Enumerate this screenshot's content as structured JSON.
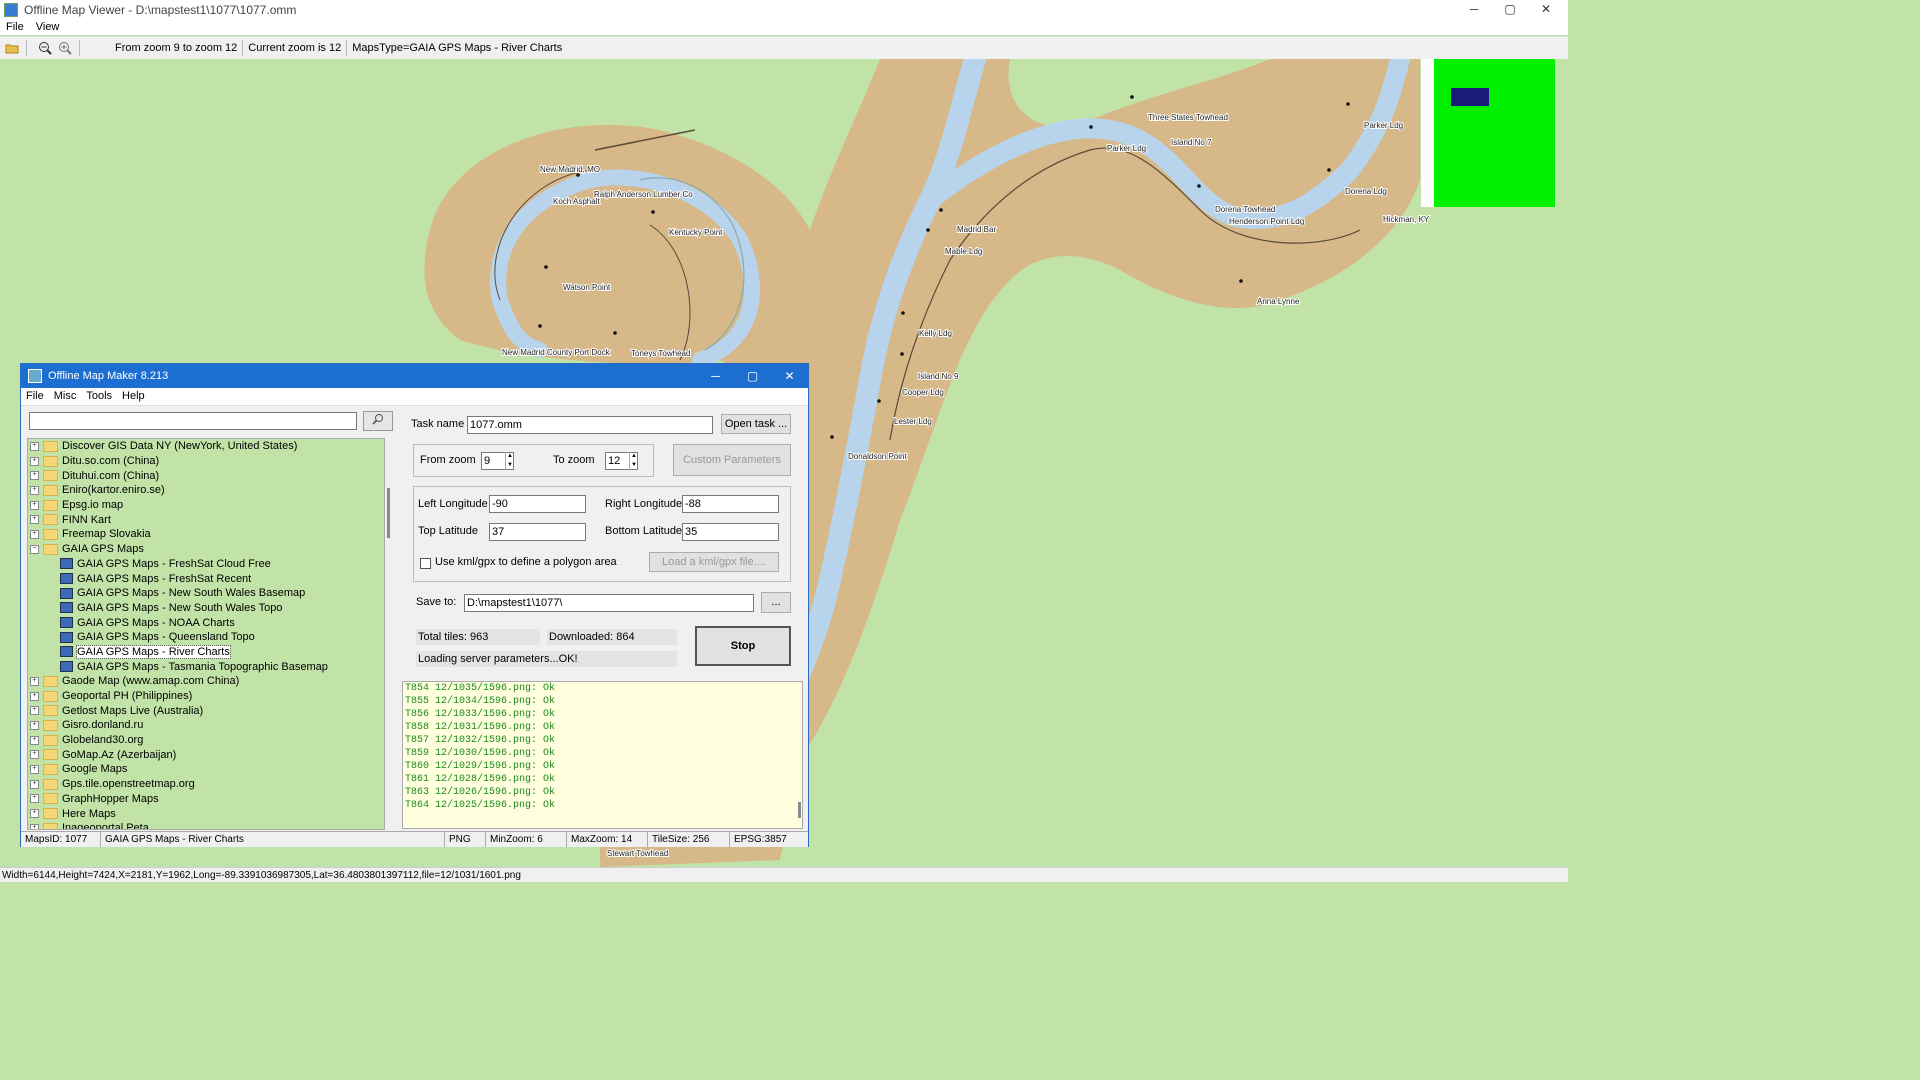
{
  "app": {
    "title": "Offline Map Viewer - D:\\mapstest1\\1077\\1077.omm",
    "window_controls": [
      "─",
      "▢",
      "✕"
    ]
  },
  "menu": [
    "File",
    "View"
  ],
  "toolbar": {
    "icons": [
      "folder-open-icon",
      "zoom-out-icon",
      "zoom-in-icon"
    ],
    "zoom_range": "From zoom 9 to zoom 12",
    "current_zoom": "Current zoom is 12",
    "maps_type": "MapsType=GAIA GPS Maps - River Charts"
  },
  "map": {
    "colors": {
      "land": "#c2e3a8",
      "floodplain": "#d6b889",
      "water": "#b8d4ec",
      "preview_box": "#00f000",
      "preview_view": "#1a1a7a"
    },
    "labels": [
      "New Madrid, MO",
      "Ralph Anderson Lumber Co",
      "Koch Asphalt",
      "Kentucky Point",
      "Watson Point",
      "New Madrid County Port Dock",
      "Toneys Towhead",
      "Three States Towhead",
      "Island No 7",
      "Parker Ldg",
      "Parker Ldg",
      "Dorena Ldg",
      "Dorena Towhead",
      "Henderson Point Ldg",
      "Hickman, KY",
      "Madrid Bar",
      "Mable Ldg",
      "Anna Lynne",
      "Kelly Ldg",
      "Island No 9",
      "Cooper Ldg",
      "Lester Ldg",
      "Donaldson Point",
      "Stewart Towhead"
    ]
  },
  "status": "Width=6144,Height=7424,X=2181,Y=1962,Long=-89.3391036987305,Lat=36.4803801397112,file=12/1031/1601.png",
  "dialog": {
    "title": "Offline Map Maker 8.213",
    "window_controls": [
      "─",
      "▢",
      "✕"
    ],
    "menu": [
      "File",
      "Misc",
      "Tools",
      "Help"
    ],
    "search": {
      "value": "",
      "icon": "search-icon"
    },
    "tree": [
      {
        "label": "Discover GIS Data NY (NewYork, United States)",
        "type": "folder",
        "expanded": false
      },
      {
        "label": "Ditu.so.com (China)",
        "type": "folder",
        "expanded": false
      },
      {
        "label": "Dituhui.com (China)",
        "type": "folder",
        "expanded": false
      },
      {
        "label": "Eniro(kartor.eniro.se)",
        "type": "folder",
        "expanded": false
      },
      {
        "label": "Epsg.io map",
        "type": "folder",
        "expanded": false
      },
      {
        "label": "FINN Kart",
        "type": "folder",
        "expanded": false
      },
      {
        "label": "Freemap Slovakia",
        "type": "folder",
        "expanded": false
      },
      {
        "label": "GAIA GPS Maps",
        "type": "folder",
        "expanded": true
      },
      {
        "label": "GAIA GPS Maps - FreshSat Cloud Free",
        "type": "leaf"
      },
      {
        "label": "GAIA GPS Maps - FreshSat Recent",
        "type": "leaf"
      },
      {
        "label": "GAIA GPS Maps - New South Wales Basemap",
        "type": "leaf"
      },
      {
        "label": "GAIA GPS Maps - New South Wales Topo",
        "type": "leaf"
      },
      {
        "label": "GAIA GPS Maps - NOAA Charts",
        "type": "leaf"
      },
      {
        "label": "GAIA GPS Maps - Queensland Topo",
        "type": "leaf"
      },
      {
        "label": "GAIA GPS Maps - River Charts",
        "type": "leaf",
        "selected": true
      },
      {
        "label": "GAIA GPS Maps - Tasmania Topographic Basemap",
        "type": "leaf"
      },
      {
        "label": "Gaode Map (www.amap.com China)",
        "type": "folder",
        "expanded": false
      },
      {
        "label": "Geoportal PH (Philippines)",
        "type": "folder",
        "expanded": false
      },
      {
        "label": "Getlost Maps Live (Australia)",
        "type": "folder",
        "expanded": false
      },
      {
        "label": "Gisro.donland.ru",
        "type": "folder",
        "expanded": false
      },
      {
        "label": "Globeland30.org",
        "type": "folder",
        "expanded": false
      },
      {
        "label": "GoMap.Az (Azerbaijan)",
        "type": "folder",
        "expanded": false
      },
      {
        "label": "Google Maps",
        "type": "folder",
        "expanded": false
      },
      {
        "label": "Gps.tile.openstreetmap.org",
        "type": "folder",
        "expanded": false
      },
      {
        "label": "GraphHopper Maps",
        "type": "folder",
        "expanded": false
      },
      {
        "label": "Here Maps",
        "type": "folder",
        "expanded": false
      },
      {
        "label": "Inageoportal Peta",
        "type": "folder",
        "expanded": false
      }
    ],
    "task_name_label": "Task name",
    "task_name_value": "1077.omm",
    "open_task": "Open task ...",
    "from_zoom_label": "From zoom",
    "from_zoom_value": "9",
    "to_zoom_label": "To zoom",
    "to_zoom_value": "12",
    "custom_params": "Custom Parameters",
    "left_lon_label": "Left Longitude",
    "left_lon_value": "-90",
    "right_lon_label": "Right Longitude",
    "right_lon_value": "-88",
    "top_lat_label": "Top Latitude",
    "top_lat_value": "37",
    "bottom_lat_label": "Bottom Latitude",
    "bottom_lat_value": "35",
    "kml_checkbox": "Use kml/gpx to define a polygon area",
    "kml_checked": false,
    "load_kml": "Load a kml/gpx file....",
    "save_to_label": "Save to:",
    "save_to_value": "D:\\mapstest1\\1077\\",
    "browse": "...",
    "total_tiles": "Total tiles: 963",
    "downloaded": "Downloaded: 864",
    "server_status": "Loading server parameters...OK!",
    "stop": "Stop",
    "log": [
      "T854 12/1035/1596.png: Ok",
      "T855 12/1034/1596.png: Ok",
      "T856 12/1033/1596.png: Ok",
      "T858 12/1031/1596.png: Ok",
      "T857 12/1032/1596.png: Ok",
      "T859 12/1030/1596.png: Ok",
      "T860 12/1029/1596.png: Ok",
      "T861 12/1028/1596.png: Ok",
      "T863 12/1026/1596.png: Ok",
      "T864 12/1025/1596.png: Ok"
    ],
    "statusbar": {
      "maps_id": "MapsID: 1077",
      "maps_name": "GAIA GPS Maps - River Charts",
      "format": "PNG",
      "min_zoom": "MinZoom: 6",
      "max_zoom": "MaxZoom: 14",
      "tile_size": "TileSize: 256",
      "epsg": "EPSG:3857"
    }
  }
}
